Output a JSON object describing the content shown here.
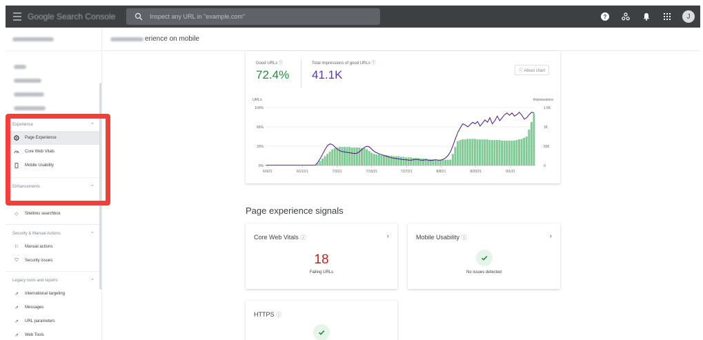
{
  "topbar": {
    "app_title": "Google Search Console",
    "search_placeholder": "Inspect any URL in \"example.com\"",
    "avatar_letter": "J",
    "bg_color": "#3c4043"
  },
  "header": {
    "title_suffix": "erience on mobile"
  },
  "sidebar": {
    "experience_label": "Experience",
    "experience_items": [
      {
        "label": "Page Experience",
        "icon": "page-experience-icon",
        "active": true
      },
      {
        "label": "Core Web Vitals",
        "icon": "speed-icon"
      },
      {
        "label": "Mobile Usability",
        "icon": "phone-icon"
      }
    ],
    "enhancements_label": "Enhancements",
    "enhancement_items": [
      {
        "label": "Sitelinks searchbox",
        "icon": "diamond-icon"
      }
    ],
    "security_label": "Security & Manual Actions",
    "security_items": [
      {
        "label": "Manual actions",
        "icon": "flag-icon"
      },
      {
        "label": "Security issues",
        "icon": "shield-icon"
      }
    ],
    "legacy_label": "Legacy tools and reports",
    "legacy_items": [
      {
        "label": "International targeting",
        "icon": "external-link-icon"
      },
      {
        "label": "Messages",
        "icon": "external-link-icon"
      },
      {
        "label": "URL parameters",
        "icon": "external-link-icon"
      },
      {
        "label": "Web Tools",
        "icon": "external-link-icon"
      }
    ],
    "highlight_color": "#f23f3a"
  },
  "metrics": {
    "good_urls_label": "Good URLs",
    "good_urls_value": "72.4%",
    "good_urls_color": "#1e8e3e",
    "impressions_label": "Total impressions of good URLs",
    "impressions_value": "41.1K",
    "impressions_color": "#5e35b1",
    "about_chart": "About chart"
  },
  "chart_data": {
    "type": "bar",
    "left_axis_title": "URLs",
    "right_axis_title": "Impressions",
    "left_ticks": [
      "100%",
      "66%",
      "33%",
      "0%"
    ],
    "right_ticks": [
      "1.5K",
      "1K",
      "500",
      "0"
    ],
    "x_ticks": [
      "6/9/21",
      "6/21/21",
      "7/3/21",
      "7/15/21",
      "7/27/21",
      "8/8/21",
      "8/20/21",
      "9/1/21"
    ],
    "series": [
      {
        "name": "Good URLs",
        "unit": "%",
        "color": "#81c995",
        "values": [
          1,
          1,
          1,
          1,
          1,
          1,
          1,
          1,
          1,
          1,
          1,
          1,
          1,
          1,
          1,
          1,
          1,
          1,
          1,
          1,
          1,
          4,
          8,
          12,
          16,
          20,
          24,
          28,
          30,
          31,
          32,
          32,
          32,
          32,
          32,
          31,
          31,
          31,
          31,
          30,
          30,
          28,
          25,
          22,
          20,
          19,
          19,
          18,
          18,
          18,
          17,
          17,
          16,
          16,
          16,
          15,
          15,
          14,
          14,
          14,
          13,
          13,
          13,
          12,
          12,
          12,
          11,
          11,
          11,
          10,
          10,
          10,
          10,
          10,
          10,
          10,
          20,
          32,
          42,
          44,
          45,
          45,
          46,
          46,
          46,
          46,
          45,
          45,
          45,
          45,
          45,
          44,
          44,
          44,
          44,
          44,
          43,
          43,
          43,
          43,
          43,
          43,
          44,
          45,
          46,
          48,
          50,
          62,
          75,
          90
        ]
      },
      {
        "name": "Impressions",
        "unit": "count",
        "color": "#4a148c",
        "values": [
          10,
          10,
          10,
          10,
          10,
          10,
          10,
          10,
          10,
          10,
          10,
          10,
          10,
          10,
          10,
          10,
          10,
          10,
          10,
          10,
          10,
          80,
          180,
          300,
          420,
          520,
          560,
          540,
          480,
          420,
          380,
          360,
          350,
          340,
          330,
          320,
          310,
          320,
          360,
          420,
          470,
          500,
          480,
          420,
          360,
          330,
          300,
          280,
          260,
          240,
          220,
          200,
          190,
          180,
          170,
          160,
          150,
          150,
          140,
          140,
          150,
          160,
          150,
          140,
          140,
          150,
          140,
          130,
          140,
          150,
          140,
          140,
          160,
          200,
          260,
          360,
          520,
          700,
          860,
          980,
          1080,
          1050,
          1000,
          1060,
          1120,
          1080,
          1140,
          1020,
          1100,
          1180,
          1120,
          1240,
          1080,
          1160,
          1280,
          1160,
          1240,
          1320,
          1360,
          1300,
          1360,
          1280,
          1320,
          1380,
          1300,
          1200,
          1240,
          1320,
          1380,
          1360
        ]
      }
    ],
    "left_max": 100,
    "right_max": 1500
  },
  "signals": {
    "title": "Page experience signals",
    "cwv": {
      "title": "Core Web Vitals",
      "value": "18",
      "sub": "Failing URLs"
    },
    "mobile": {
      "title": "Mobile Usability",
      "sub": "No issues detected"
    },
    "https": {
      "title": "HTTPS"
    }
  }
}
